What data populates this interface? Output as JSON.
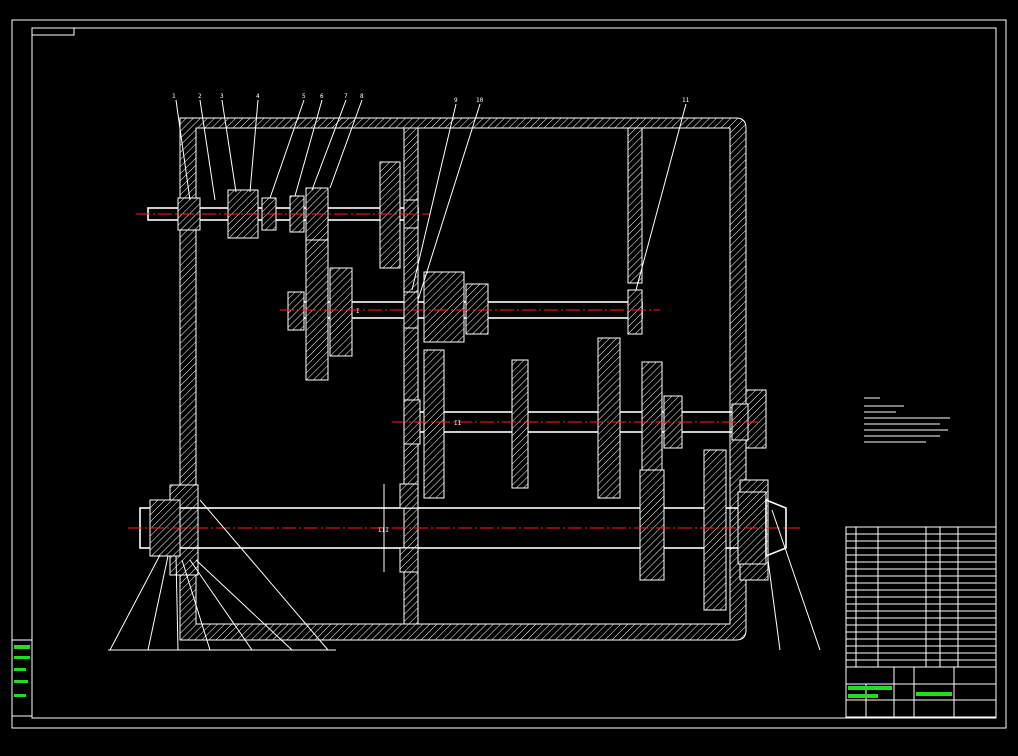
{
  "drawing": {
    "numbers_top": [
      "1",
      "2",
      "3",
      "4",
      "5",
      "6",
      "7",
      "8",
      "9",
      "10",
      "11"
    ],
    "shaft_labels": [
      "I",
      "II",
      "III"
    ]
  },
  "colors": {
    "background": "#000000",
    "lines": "#ffffff",
    "centerline": "#ff2020",
    "title_text": "#22dd22"
  }
}
